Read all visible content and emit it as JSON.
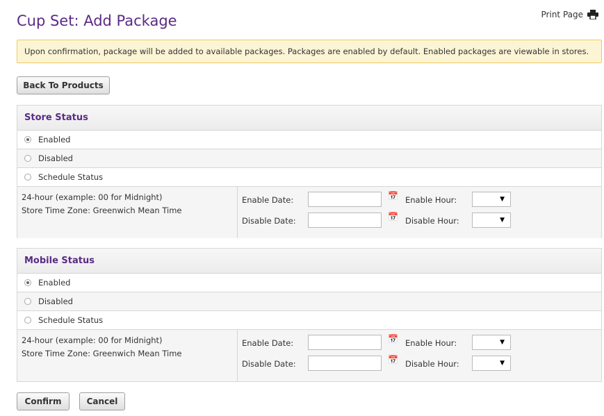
{
  "page": {
    "title": "Cup Set: Add Package",
    "print_label": "Print Page",
    "notice": "Upon confirmation, package will be added to available packages. Packages are enabled by default. Enabled packages are viewable in stores.",
    "back_button": "Back To Products"
  },
  "store_status": {
    "heading": "Store Status",
    "options": [
      {
        "label": "Enabled",
        "checked": true
      },
      {
        "label": "Disabled",
        "checked": false
      },
      {
        "label": "Schedule Status",
        "checked": false
      }
    ],
    "schedule": {
      "hint_line1": "24-hour (example: 00 for Midnight)",
      "hint_line2": "Store Time Zone: Greenwich Mean Time",
      "enable_date_label": "Enable Date:",
      "disable_date_label": "Disable Date:",
      "enable_hour_label": "Enable Hour:",
      "disable_hour_label": "Disable Hour:",
      "enable_date_value": "",
      "disable_date_value": "",
      "enable_hour_value": "",
      "disable_hour_value": ""
    }
  },
  "mobile_status": {
    "heading": "Mobile Status",
    "options": [
      {
        "label": "Enabled",
        "checked": true
      },
      {
        "label": "Disabled",
        "checked": false
      },
      {
        "label": "Schedule Status",
        "checked": false
      }
    ],
    "schedule": {
      "hint_line1": "24-hour (example: 00 for Midnight)",
      "hint_line2": "Store Time Zone: Greenwich Mean Time",
      "enable_date_label": "Enable Date:",
      "disable_date_label": "Disable Date:",
      "enable_hour_label": "Enable Hour:",
      "disable_hour_label": "Disable Hour:",
      "enable_date_value": "",
      "disable_date_value": "",
      "enable_hour_value": "",
      "disable_hour_value": ""
    }
  },
  "actions": {
    "confirm": "Confirm",
    "cancel": "Cancel"
  },
  "icons": {
    "print": "printer-icon",
    "calendar": "calendar-icon",
    "dropdown": "chevron-down-icon"
  },
  "colors": {
    "title": "#5b2a86",
    "notice_bg": "#fcf5d5",
    "notice_border": "#f1c95a"
  }
}
